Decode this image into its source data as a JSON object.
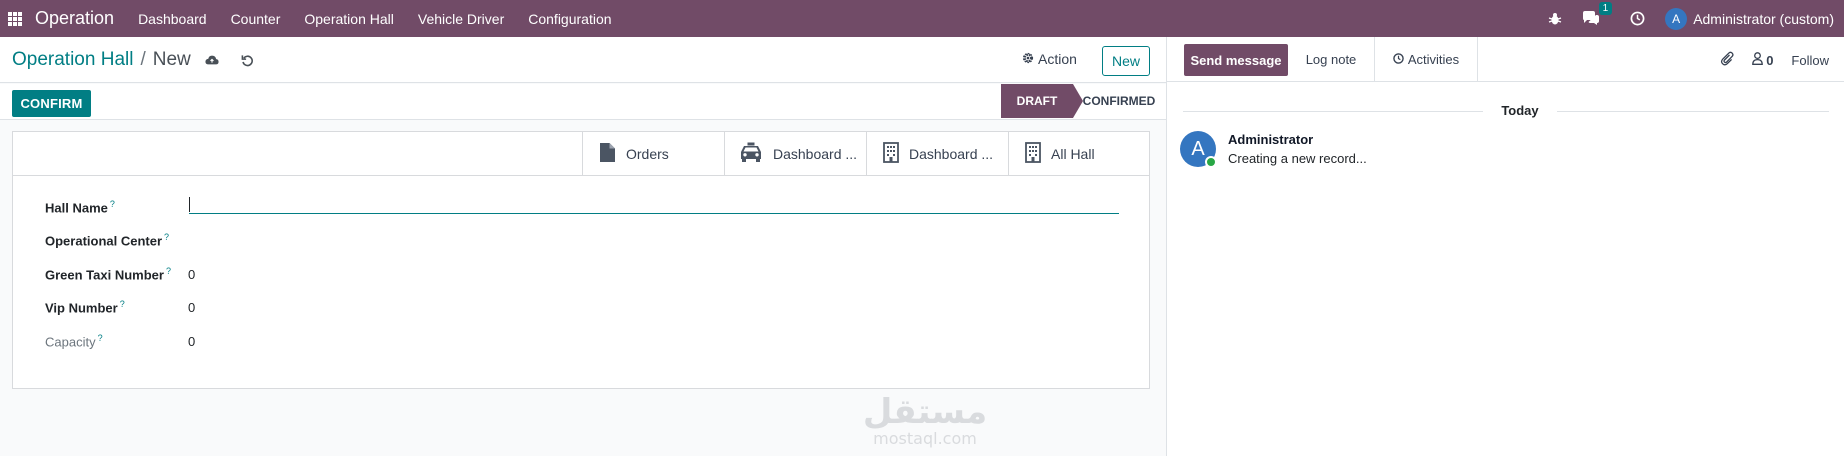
{
  "navbar": {
    "app_name": "Operation",
    "menu": [
      "Dashboard",
      "Counter",
      "Operation Hall",
      "Vehicle Driver",
      "Configuration"
    ],
    "messages_count": "1",
    "user_initial": "A",
    "user_name": "Administrator (custom)",
    "bg_color": "#714B67"
  },
  "control": {
    "breadcrumb_parent": "Operation Hall",
    "breadcrumb_separator": "/",
    "breadcrumb_current": "New",
    "action_label": "Action",
    "new_label": "New"
  },
  "statusbar": {
    "confirm_label": "CONFIRM",
    "stages": [
      "DRAFT",
      "CONFIRMED"
    ],
    "active_stage": "DRAFT"
  },
  "smart_buttons": [
    {
      "label": "Orders",
      "icon": "file-icon"
    },
    {
      "label": "Dashboard ...",
      "icon": "taxi-icon"
    },
    {
      "label": "Dashboard ...",
      "icon": "building-icon"
    },
    {
      "label": "All Hall",
      "icon": "building-icon"
    }
  ],
  "form": {
    "fields": [
      {
        "label": "Hall Name",
        "help": "?",
        "value": ""
      },
      {
        "label": "Operational Center",
        "help": "?",
        "value": ""
      },
      {
        "label": "Green Taxi Number",
        "help": "?",
        "value": "0"
      },
      {
        "label": "Vip Number",
        "help": "?",
        "value": "0"
      },
      {
        "label": "Capacity",
        "help": "?",
        "value": "0"
      }
    ]
  },
  "chatter": {
    "send_message_label": "Send message",
    "log_note_label": "Log note",
    "activities_label": "Activities",
    "followers_count": "0",
    "follow_label": "Follow",
    "date_separator": "Today",
    "message": {
      "avatar_initial": "A",
      "author": "Administrator",
      "body": "Creating a new record..."
    }
  },
  "watermark": {
    "arabic": "مستقل",
    "latin": "mostaql.com"
  },
  "colors": {
    "brand": "#714B67",
    "accent": "#017E84",
    "avatar": "#3476C0",
    "online": "#28a745"
  }
}
